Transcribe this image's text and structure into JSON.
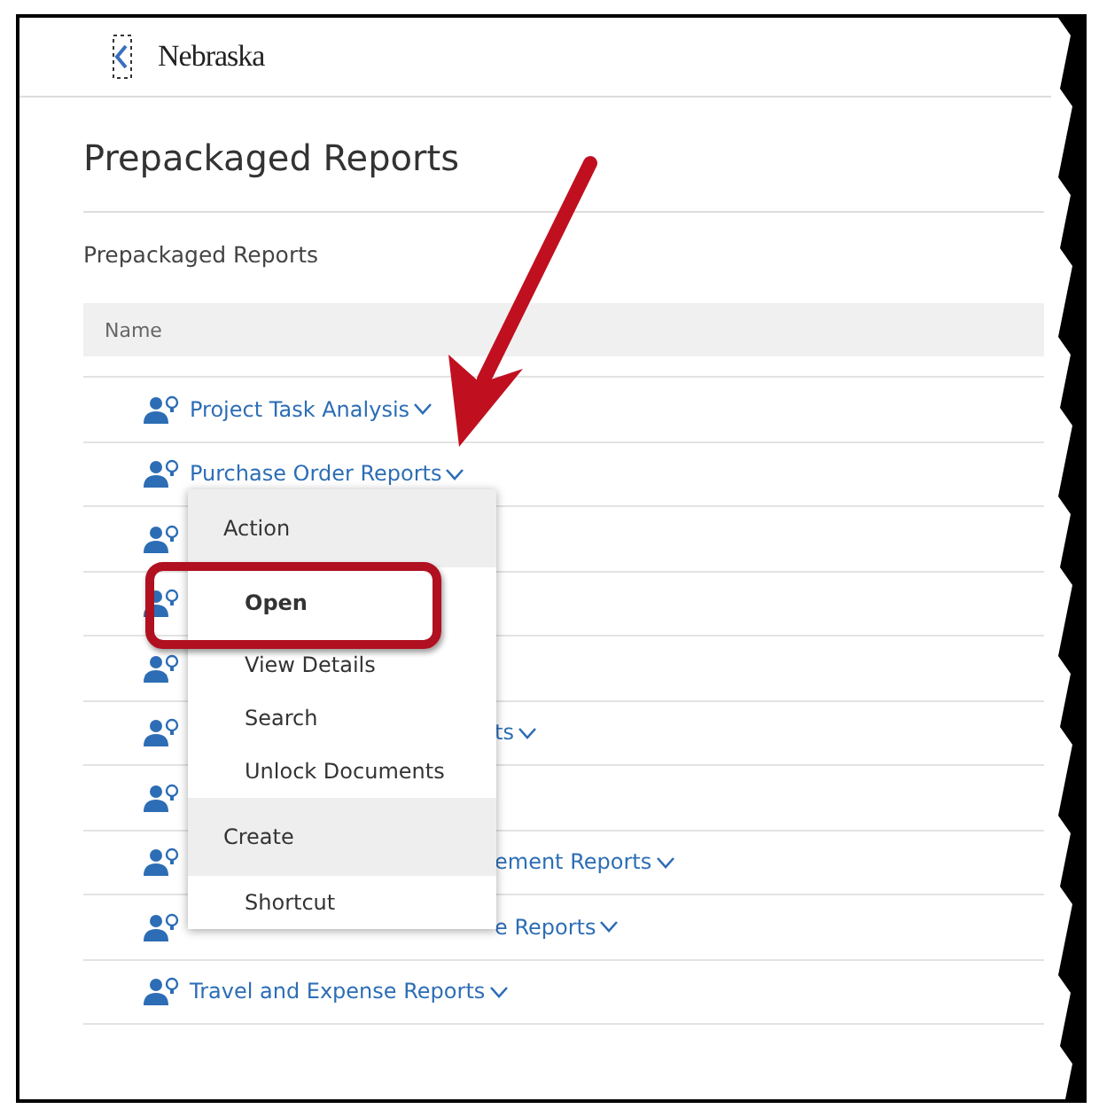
{
  "logo": {
    "text": "Nebraska"
  },
  "page_title": "Prepackaged Reports",
  "breadcrumb": "Prepackaged Reports",
  "table": {
    "columns": [
      "Name"
    ],
    "rows": [
      {
        "kind": "link",
        "label": "Project Task Analysis"
      },
      {
        "kind": "link",
        "label": "Purchase Order Reports"
      },
      {
        "kind": "covered"
      },
      {
        "kind": "covered"
      },
      {
        "kind": "covered"
      },
      {
        "kind": "partial",
        "label": "ts"
      },
      {
        "kind": "covered"
      },
      {
        "kind": "partial",
        "label": "ement Reports"
      },
      {
        "kind": "partial",
        "label": "e Reports"
      },
      {
        "kind": "link",
        "label": "Travel and Expense Reports"
      }
    ]
  },
  "menu": {
    "items": [
      {
        "kind": "header",
        "label": "Action"
      },
      {
        "kind": "item",
        "label": "Open",
        "highlighted": true
      },
      {
        "kind": "item",
        "label": "View Details",
        "highlighted": false
      },
      {
        "kind": "item",
        "label": "Search",
        "highlighted": false
      },
      {
        "kind": "item",
        "label": "Unlock Documents",
        "highlighted": false
      },
      {
        "kind": "header",
        "label": "Create"
      },
      {
        "kind": "item",
        "label": "Shortcut",
        "highlighted": false
      }
    ]
  },
  "annotations": [
    {
      "kind": "arrow"
    }
  ]
}
